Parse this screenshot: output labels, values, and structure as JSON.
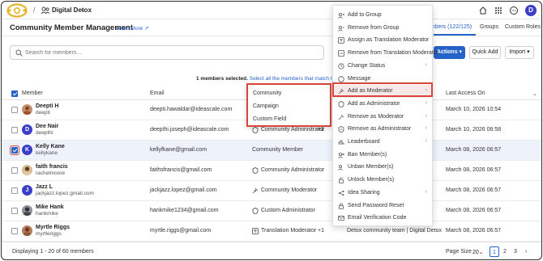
{
  "topbar": {
    "workspace": "Digital Detox",
    "separator": "/",
    "avatar_letter": "D"
  },
  "header": {
    "title": "Community Member Management",
    "learn_more": "Learn More",
    "tabs": [
      {
        "label": "Members (122/125)",
        "active": true
      },
      {
        "label": "Groups",
        "active": false
      },
      {
        "label": "Custom Roles",
        "active": false
      }
    ]
  },
  "search": {
    "placeholder": "Search for members..."
  },
  "toolbar": {
    "actions": "Actions",
    "quick_add": "Quick Add",
    "import": "Import"
  },
  "selection": {
    "count_text": "1 members selected.",
    "select_all": "Select all the members that match this"
  },
  "table": {
    "headers": {
      "member": "Member",
      "email": "Email",
      "last_access": "Last Access On"
    },
    "rows": [
      {
        "name": "Deepti H",
        "username": "deepti",
        "email": "deepti.hawaldar@ideascale.com",
        "role": "",
        "extra": "",
        "date": "March 10, 2026 10:54",
        "avatar": "photo",
        "checked": false
      },
      {
        "name": "Dee Nair",
        "username": "deepthi",
        "email": "deepthi.joseph@ideascale.com",
        "role": "Community Administrator",
        "extra": "+1",
        "date": "March 10, 2026 06:58",
        "avatar": "D",
        "checked": false
      },
      {
        "name": "Kelly Kane",
        "username": "kellykane",
        "email": "kellyfkane@gmail.com",
        "role": "Community Member",
        "extra": "",
        "date": "March 08, 2026 06:57",
        "avatar": "K",
        "checked": true
      },
      {
        "name": "faith francis",
        "username": "rachelmoore",
        "email": "faithsfrancis@gmail.com",
        "role": "Community Administrator",
        "extra": "",
        "date": "March 08, 2026 06:57",
        "avatar": "photo",
        "checked": false
      },
      {
        "name": "Jazz L",
        "username": "jackjazz.lopez.gmail.com",
        "email": "jackjazz.lopez@gmail.com",
        "role": "Community Moderator",
        "extra": "",
        "date": "March 08, 2026 06:57",
        "avatar": "J",
        "checked": false
      },
      {
        "name": "Mike Hank",
        "username": "hankmike",
        "email": "hankmike1234@gmail.com",
        "role": "Custom Administrator",
        "extra": "",
        "date": "March 08, 2026 06:57",
        "avatar": "photo",
        "checked": false
      },
      {
        "name": "Myrtle Riggs",
        "username": "myrtleriggs",
        "email": "myrtle.riggs@gmail.com",
        "role": "Translation Moderator",
        "extra": "+1",
        "team": "Detox community team | Digital Detox",
        "date": "March 08, 2026 06:57",
        "avatar": "photo",
        "checked": false
      }
    ]
  },
  "submenu": {
    "items": [
      "Community",
      "Campaign",
      "Custom Field"
    ]
  },
  "menu": {
    "items": [
      {
        "label": "Add to Group",
        "icon": "group-add-icon",
        "arrow": false
      },
      {
        "label": "Remove from Group",
        "icon": "group-remove-icon",
        "arrow": false
      },
      {
        "label": "Assign as Translation Moderator",
        "icon": "translate-icon",
        "arrow": false
      },
      {
        "label": "Remove from Translation Moderator",
        "icon": "translate-remove-icon",
        "arrow": false
      },
      {
        "label": "Change Status",
        "icon": "status-icon",
        "arrow": true
      },
      {
        "label": "Message",
        "icon": "message-icon",
        "arrow": false
      },
      {
        "label": "Add as Moderator",
        "icon": "moderator-add-icon",
        "arrow": true,
        "active": true
      },
      {
        "label": "Add as Administrator",
        "icon": "admin-add-icon",
        "arrow": true
      },
      {
        "label": "Remove as Moderator",
        "icon": "moderator-remove-icon",
        "arrow": true
      },
      {
        "label": "Remove as Administrator",
        "icon": "admin-remove-icon",
        "arrow": true
      },
      {
        "label": "Leaderboard",
        "icon": "leaderboard-icon",
        "arrow": true
      },
      {
        "label": "Ban Member(s)",
        "icon": "ban-icon",
        "arrow": false
      },
      {
        "label": "Unban Member(s)",
        "icon": "unban-icon",
        "arrow": false
      },
      {
        "label": "Unlock Member(s)",
        "icon": "unlock-icon",
        "arrow": false
      },
      {
        "label": "Idea Sharing",
        "icon": "share-icon",
        "arrow": true
      },
      {
        "label": "Send Password Reset",
        "icon": "password-icon",
        "arrow": false
      },
      {
        "label": "Email Verification Code",
        "icon": "email-icon",
        "arrow": false
      }
    ]
  },
  "footer": {
    "displaying": "Displaying 1 - 20 of 60 members",
    "page_size_label": "Page Size",
    "page_size_value": "20",
    "pages": [
      "1",
      "2",
      "3"
    ],
    "next": "›"
  },
  "colors": {
    "accent": "#2563c7",
    "highlight": "#d9453b"
  }
}
